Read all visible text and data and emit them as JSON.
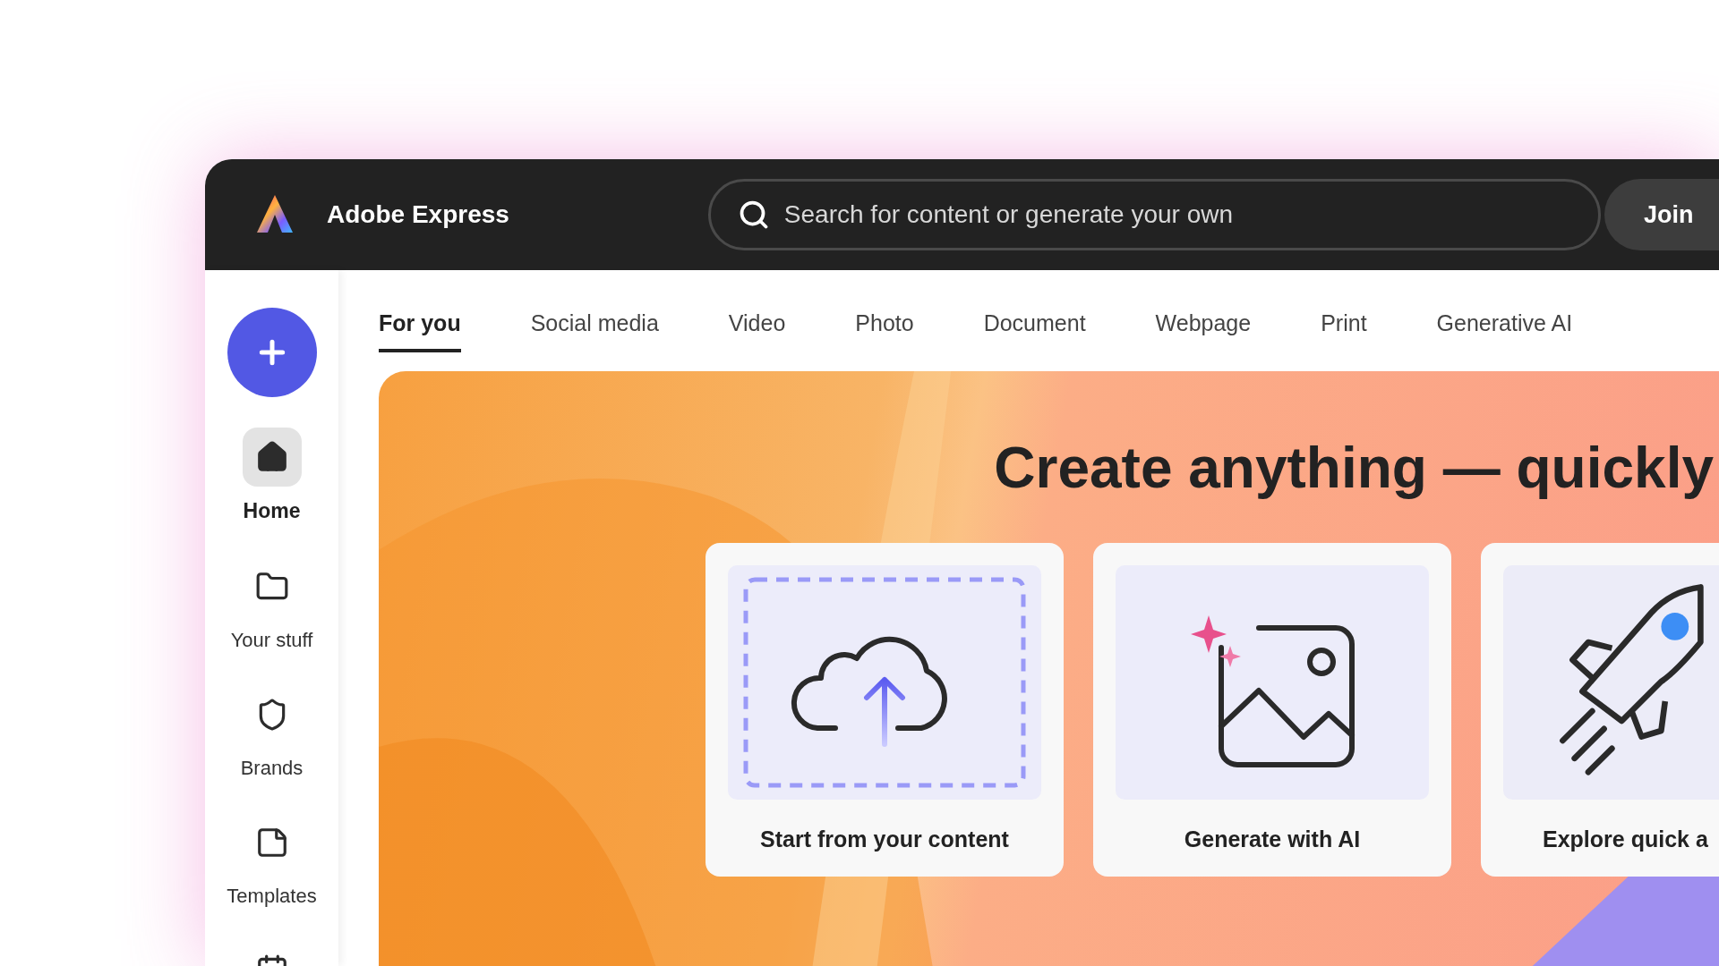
{
  "app": {
    "name": "Adobe Express"
  },
  "search": {
    "placeholder": "Search for content or generate your own"
  },
  "join_button": "Join",
  "sidebar": {
    "items": [
      {
        "kind": "home",
        "label": "Home",
        "selected": true
      },
      {
        "kind": "folder",
        "label": "Your stuff",
        "selected": false
      },
      {
        "kind": "brand",
        "label": "Brands",
        "selected": false
      },
      {
        "kind": "template",
        "label": "Templates",
        "selected": false
      },
      {
        "kind": "calendar",
        "selected": false
      }
    ]
  },
  "tabs": [
    {
      "label": "For you",
      "selected": true
    },
    {
      "label": "Social media",
      "selected": false
    },
    {
      "label": "Video",
      "selected": false
    },
    {
      "label": "Photo",
      "selected": false
    },
    {
      "label": "Document",
      "selected": false
    },
    {
      "label": "Webpage",
      "selected": false
    },
    {
      "label": "Print",
      "selected": false
    },
    {
      "label": "Generative AI",
      "selected": false
    }
  ],
  "hero": {
    "heading": "Create anything — quickly",
    "cards": [
      {
        "kind": "upload",
        "label": "Start from your content"
      },
      {
        "kind": "generate",
        "label": "Generate with AI"
      },
      {
        "kind": "quick",
        "label": "Explore quick a"
      }
    ]
  }
}
